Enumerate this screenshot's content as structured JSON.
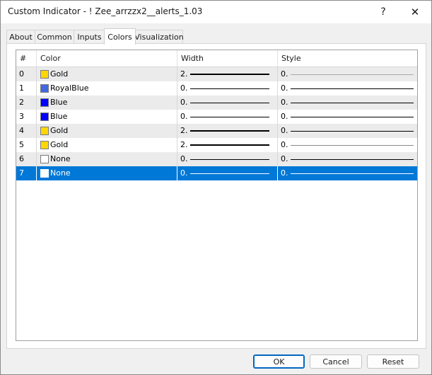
{
  "window": {
    "title": "Custom Indicator - ! Zee_arrzzx2__alerts_1.03",
    "help_glyph": "?",
    "close_glyph": "✕"
  },
  "tabs": [
    {
      "label": "About"
    },
    {
      "label": "Common"
    },
    {
      "label": "Inputs"
    },
    {
      "label": "Colors",
      "active": true
    },
    {
      "label": "Visualization"
    }
  ],
  "grid": {
    "headers": {
      "num": "#",
      "color": "Color",
      "width": "Width",
      "style": "Style"
    },
    "rows": [
      {
        "num": "0",
        "color_name": "Gold",
        "color_hex": "#ffd700",
        "width": "2.",
        "style": "0."
      },
      {
        "num": "1",
        "color_name": "RoyalBlue",
        "color_hex": "#4169e1",
        "width": "0.",
        "style": "0."
      },
      {
        "num": "2",
        "color_name": "Blue",
        "color_hex": "#0000ff",
        "width": "0.",
        "style": "0."
      },
      {
        "num": "3",
        "color_name": "Blue",
        "color_hex": "#0000ff",
        "width": "0.",
        "style": "0."
      },
      {
        "num": "4",
        "color_name": "Gold",
        "color_hex": "#ffd700",
        "width": "2.",
        "style": "0."
      },
      {
        "num": "5",
        "color_name": "Gold",
        "color_hex": "#ffd700",
        "width": "2.",
        "style": "0."
      },
      {
        "num": "6",
        "color_name": "None",
        "color_hex": "#ffffff",
        "width": "0.",
        "style": "0."
      },
      {
        "num": "7",
        "color_name": "None",
        "color_hex": "#ffffff",
        "width": "0.",
        "style": "0.",
        "selected": true
      }
    ]
  },
  "buttons": {
    "ok": "OK",
    "cancel": "Cancel",
    "reset": "Reset"
  },
  "colors": {
    "selection": "#0078d7",
    "alt_row": "#ebebeb"
  }
}
